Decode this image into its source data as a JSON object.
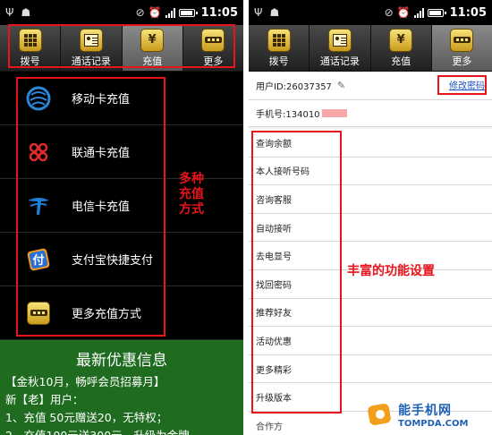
{
  "status_bar": {
    "time": "11:05",
    "battery_level": 0.85
  },
  "tabs": [
    {
      "label": "拨号",
      "icon": "dialpad-icon"
    },
    {
      "label": "通话记录",
      "icon": "contact-card-icon"
    },
    {
      "label": "充值",
      "icon": "recharge-icon"
    },
    {
      "label": "更多",
      "icon": "more-icon"
    }
  ],
  "left_screen": {
    "active_tab": "充值",
    "recharge_options": [
      {
        "label": "移动卡充值",
        "icon": "china-mobile-icon"
      },
      {
        "label": "联通卡充值",
        "icon": "china-unicom-icon"
      },
      {
        "label": "电信卡充值",
        "icon": "china-telecom-icon"
      },
      {
        "label": "支付宝快捷支付",
        "icon": "alipay-icon"
      },
      {
        "label": "更多充值方式",
        "icon": "more-icon"
      }
    ],
    "annotation": "多种充值方式",
    "promo": {
      "title": "最新优惠信息",
      "lines": [
        "【金秋10月，畅呼会员招募月】",
        "新【老】用户：",
        "1、充值 50元赠送20，无特权；",
        "2、充值100元送300元，升级为金牌"
      ]
    }
  },
  "right_screen": {
    "active_tab": "更多",
    "user_id_label": "用户ID:26037357",
    "change_password": "修改密码",
    "phone_label": "手机号:134010",
    "features": [
      "查询余额",
      "本人接听号码",
      "咨询客服",
      "自动接听",
      "去电显号",
      "找回密码",
      "推荐好友",
      "活动优惠",
      "更多精彩",
      "升级版本",
      "合作方"
    ],
    "annotation": "丰富的功能设置"
  },
  "watermark": {
    "cn": "能手机网",
    "en": "TOMPDA.COM"
  },
  "colors": {
    "annotation_red": "#e8131b",
    "promo_green": "#1f6b1f",
    "tab_gold": "#e0b93a",
    "link_blue": "#1a4fc7"
  }
}
